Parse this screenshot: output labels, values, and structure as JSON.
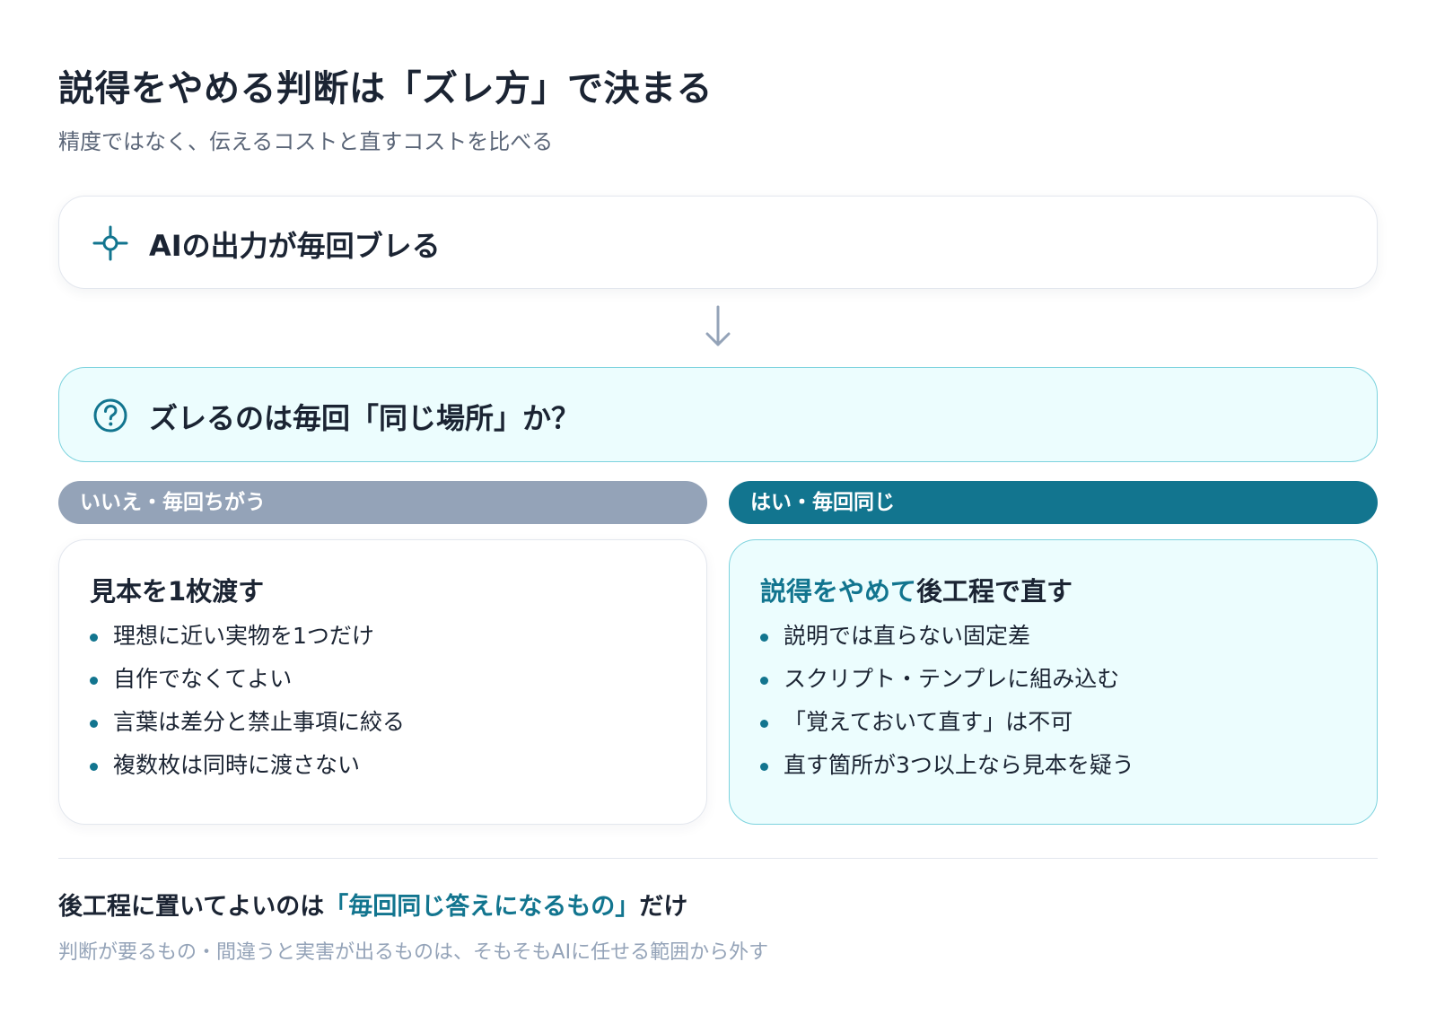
{
  "header": {
    "title": "説得をやめる判断は「ズレ方」で決まる",
    "subtitle": "精度ではなく、伝えるコストと直すコストを比べる"
  },
  "problem": {
    "icon": "crosshair-icon",
    "text": "AIの出力が毎回ブレる"
  },
  "flow_arrow": {
    "icon": "arrow-down-icon"
  },
  "question": {
    "icon": "question-circle-icon",
    "text": "ズレるのは毎回「同じ場所」か？"
  },
  "branches": {
    "no": {
      "label": "いいえ・毎回ちがう",
      "title": "見本を1枚渡す",
      "items": [
        "理想に近い実物を1つだけ",
        "自作でなくてよい",
        "言葉は差分と禁止事項に絞る",
        "複数枚は同時に渡さない"
      ]
    },
    "yes": {
      "label": "はい・毎回同じ",
      "title_accent": "説得をやめて",
      "title_rest": "後工程で直す",
      "items": [
        "説明では直らない固定差",
        "スクリプト・テンプレに組み込む",
        "「覚えておいて直す」は不可",
        "直す箇所が3つ以上なら見本を疑う"
      ]
    }
  },
  "conclusion": {
    "prefix": "後工程に置いてよいのは",
    "accent": "「毎回同じ答えになるもの」",
    "suffix": "だけ"
  },
  "note": "判断が要るもの・間違うと実害が出るものは、そもそもAIに任せる範囲から外す",
  "colors": {
    "accent": "#12758f",
    "text": "#1b2433",
    "muted": "#94a3b8",
    "highlight_bg": "#ecfdfe",
    "highlight_border": "#7dd3de"
  }
}
